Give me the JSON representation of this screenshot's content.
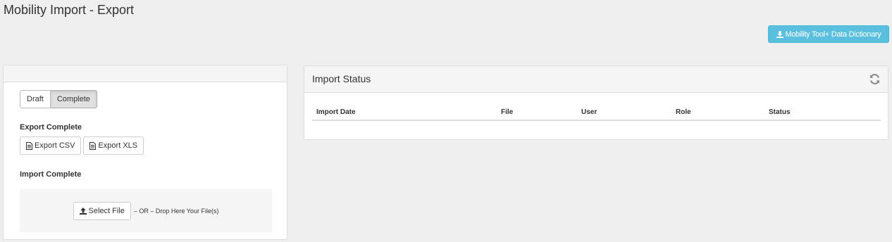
{
  "page": {
    "title": "Mobility Import - Export"
  },
  "header": {
    "dictionary_button": "Mobility Tool+ Data Dictionary"
  },
  "left_panel": {
    "toggle": {
      "options": [
        "Draft",
        "Complete"
      ],
      "selected": "Complete"
    },
    "export_section": {
      "label": "Export Complete",
      "csv_button": "Export CSV",
      "xls_button": "Export XLS"
    },
    "import_section": {
      "label": "Import Complete",
      "select_file_button": "Select File",
      "drop_text": "– OR – Drop Here Your File(s)"
    }
  },
  "import_status": {
    "title": "Import Status",
    "columns": [
      "Import Date",
      "File",
      "User",
      "Role",
      "Status"
    ],
    "rows": []
  },
  "colors": {
    "info_button": "#5bc0de",
    "background": "#efefef"
  },
  "icons": [
    "download-icon",
    "document-icon",
    "upload-icon",
    "refresh-icon"
  ]
}
